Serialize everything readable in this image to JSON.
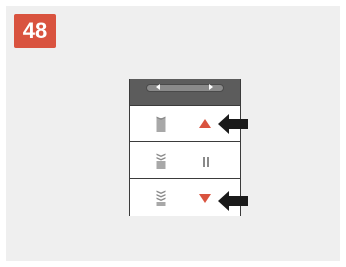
{
  "step": {
    "number": "48"
  },
  "colors": {
    "accent": "#d9533f",
    "background": "#efefef",
    "remote_border": "#3b3b3b",
    "display": "#5c5c5c"
  },
  "remote": {
    "display": {
      "left_icon": "chevron-left-icon",
      "right_icon": "chevron-right-icon"
    },
    "buttons": [
      {
        "name": "up",
        "shade_icon": "shade-open-icon",
        "action_icon": "up-arrow-icon"
      },
      {
        "name": "stop",
        "shade_icon": "shade-half-icon",
        "action_icon": "pause-icon"
      },
      {
        "name": "down",
        "shade_icon": "shade-closed-icon",
        "action_icon": "down-arrow-icon"
      }
    ]
  },
  "pointers": [
    "pointer-arrow-icon",
    "pointer-arrow-icon"
  ]
}
